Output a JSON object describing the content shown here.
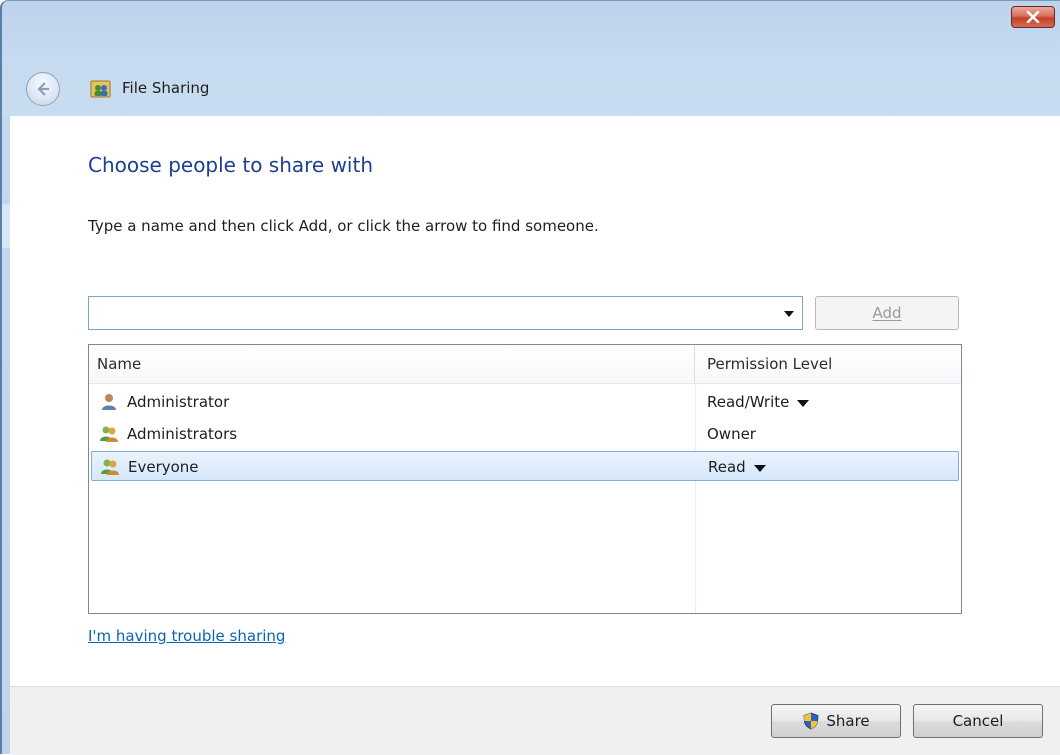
{
  "window": {
    "title": "File Sharing"
  },
  "content": {
    "heading": "Choose people to share with",
    "instruction": "Type a name and then click Add, or click the arrow to find someone."
  },
  "search": {
    "value": "",
    "placeholder": ""
  },
  "add_button": {
    "label": "Add",
    "enabled": false
  },
  "table": {
    "columns": [
      "Name",
      "Permission Level"
    ],
    "rows": [
      {
        "name": "Administrator",
        "permission": "Read/Write",
        "icon": "user-icon",
        "has_dropdown": true,
        "selected": false
      },
      {
        "name": "Administrators",
        "permission": "Owner",
        "icon": "group-icon",
        "has_dropdown": false,
        "selected": false
      },
      {
        "name": "Everyone",
        "permission": "Read",
        "icon": "group-icon",
        "has_dropdown": true,
        "selected": true
      }
    ]
  },
  "links": {
    "trouble": "I'm having trouble sharing"
  },
  "footer": {
    "share_label": "Share",
    "cancel_label": "Cancel"
  },
  "colors": {
    "heading": "#1f3f8f",
    "link": "#0a64b4",
    "selection": "#d5e7fb",
    "close": "#c2412a"
  }
}
